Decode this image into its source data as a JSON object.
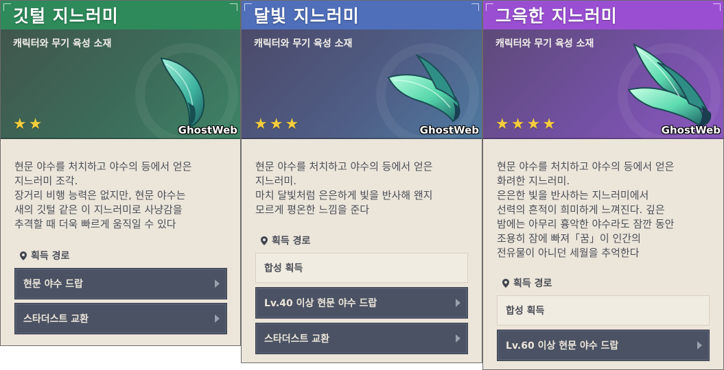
{
  "cards": [
    {
      "title": "깃털 지느러미",
      "category": "캐릭터와 무기 육성 소재",
      "rarity": 2,
      "stars": [
        "★",
        "★"
      ],
      "watermark": "GhostWeb",
      "description": [
        "현문 야수를 처치하고 야수의 등에서 얻은",
        "지느러미 조각.",
        "장거리 비행 능력은 없지만, 현문 야수는",
        "새의 깃털 같은 이 지느러미로 사냥감을",
        "추격할 때 더욱 빠르게 움직일 수 있다"
      ],
      "source_label": "획득 경로",
      "sources": [
        {
          "label": "현문 야수 드랍",
          "clickable": true
        },
        {
          "label": "스타더스트 교환",
          "clickable": true
        }
      ],
      "title_color": "#2e8a5b"
    },
    {
      "title": "달빛 지느러미",
      "category": "캐릭터와 무기 육성 소재",
      "rarity": 3,
      "stars": [
        "★",
        "★",
        "★"
      ],
      "watermark": "GhostWeb",
      "description": [
        "현문 야수를 처치하고 야수의 등에서 얻은",
        "지느러미.",
        "마치 달빛처럼 은은하게 빛을 반사해 왠지",
        "모르게 평온한 느낌을 준다"
      ],
      "source_label": "획득 경로",
      "sources": [
        {
          "label": "합성 획득",
          "clickable": false
        },
        {
          "label": "Lv.40 이상 현문 야수 드랍",
          "clickable": true
        },
        {
          "label": "스타더스트 교환",
          "clickable": true
        }
      ],
      "title_color": "#4f6fba"
    },
    {
      "title": "그윽한 지느러미",
      "category": "캐릭터와 무기 육성 소재",
      "rarity": 4,
      "stars": [
        "★",
        "★",
        "★",
        "★"
      ],
      "watermark": "GhostWeb",
      "description": [
        "현문 야수를 처치하고 야수의 등에서 얻은",
        "화려한 지느러미.",
        "은은한 빛을 반사하는 지느러미에서",
        "선력의 흔적이 희미하게 느껴진다. 깊은",
        "밤에는 아무리 흉악한 야수라도 잠깐 동안",
        "조용히 잠에 빠져「꿈」이 인간의",
        "전유물이 아니던 세월을 추억한다"
      ],
      "source_label": "획득 경로",
      "sources": [
        {
          "label": "합성 획득",
          "clickable": false
        },
        {
          "label": "Lv.60 이상 현문 야수 드랍",
          "clickable": true
        }
      ],
      "title_color": "#9a4fd2"
    }
  ]
}
